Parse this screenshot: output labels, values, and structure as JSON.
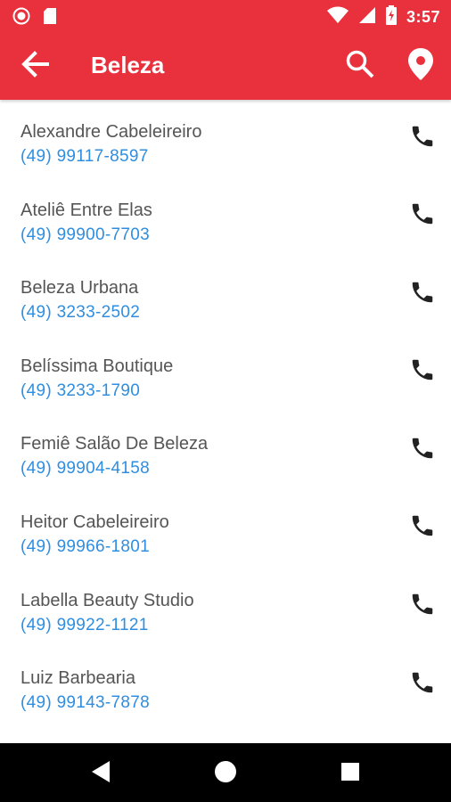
{
  "status_bar": {
    "time": "3:57",
    "icons": [
      "notification-dot-icon",
      "sd-card-icon",
      "wifi-icon",
      "signal-icon",
      "battery-charging-icon"
    ]
  },
  "app_bar": {
    "title": "Beleza",
    "icons": [
      "back-arrow-icon",
      "search-icon",
      "location-pin-icon"
    ],
    "background": "#e8313c"
  },
  "list": {
    "items": [
      {
        "name": "Alexandre Cabeleireiro",
        "phone": "(49) 99117-8597"
      },
      {
        "name": "Ateliê Entre Elas",
        "phone": "(49) 99900-7703"
      },
      {
        "name": "Beleza Urbana",
        "phone": "(49) 3233-2502"
      },
      {
        "name": "Belíssima Boutique",
        "phone": "(49) 3233-1790"
      },
      {
        "name": "Femiê Salão De Beleza",
        "phone": "(49) 99904-4158"
      },
      {
        "name": "Heitor Cabeleireiro",
        "phone": "(49) 99966-1801"
      },
      {
        "name": "Labella Beauty Studio",
        "phone": "(49) 99922-1121"
      },
      {
        "name": "Luiz Barbearia",
        "phone": "(49) 99143-7878"
      }
    ],
    "item_icon": "phone-icon",
    "name_color": "#555555",
    "phone_color": "#2f8ee0"
  },
  "nav_bar": {
    "icons": [
      "back-triangle-icon",
      "home-circle-icon",
      "recents-square-icon"
    ]
  }
}
